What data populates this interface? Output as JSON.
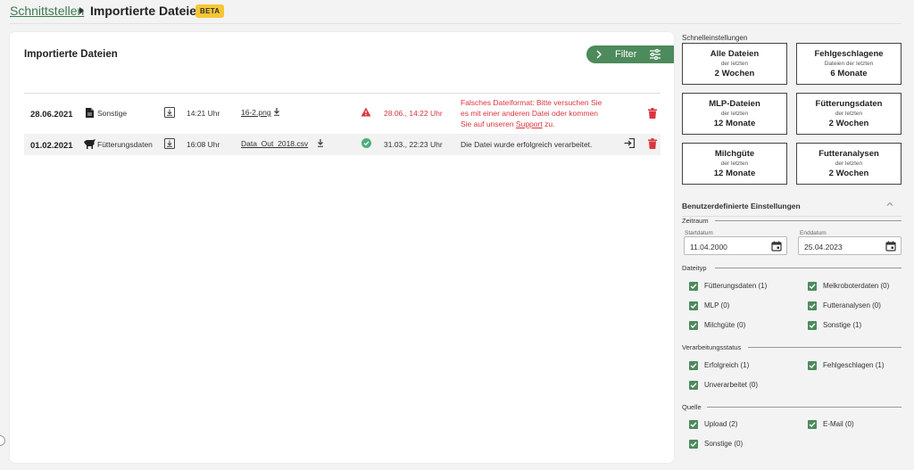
{
  "breadcrumb": {
    "parent": "Schnittstellen",
    "current": "Importierte Dateien",
    "badge": "BETA"
  },
  "main": {
    "title": "Importierte Dateien",
    "filter_label": "Filter",
    "rows": [
      {
        "date": "28.06.2021",
        "type": "Sonstige",
        "time": "14:21 Uhr",
        "file": "16-2.png",
        "processed": "28.06., 14:22 Uhr",
        "message_lines": [
          "Falsches Dateiformat: Bitte versuchen Sie",
          "es mit einer anderen Datei oder kommen",
          "Sie auf unseren"
        ],
        "support_link": "Support",
        "message_end": "zu.",
        "status": "error"
      },
      {
        "date": "01.02.2021",
        "type": "Fütterungsdaten",
        "time": "16:08 Uhr",
        "file": "Data_Out_2018.csv",
        "processed": "31.03., 22:23 Uhr",
        "message": "Die Datei wurde erfolgreich verarbeitet.",
        "status": "success"
      }
    ]
  },
  "sidebar": {
    "quick_title": "Schnelleinstellungen",
    "quick": [
      {
        "title": "Alle Dateien",
        "sub": "der letzten",
        "value": "2 Wochen"
      },
      {
        "title": "Fehlgeschlagene",
        "sub": "Dateien der letzten",
        "value": "6 Monate"
      },
      {
        "title": "MLP-Dateien",
        "sub": "der letzten",
        "value": "12 Monate"
      },
      {
        "title": "Fütterungsdaten",
        "sub": "der letzten",
        "value": "2 Wochen"
      },
      {
        "title": "Milchgüte",
        "sub": "der letzten",
        "value": "12 Monate"
      },
      {
        "title": "Futteranalysen",
        "sub": "der letzten",
        "value": "2 Wochen"
      }
    ],
    "custom_title": "Benutzerdefinierte Einstellungen",
    "zeitraum": {
      "label": "Zeitraum",
      "start_label": "Startdatum",
      "start_value": "11.04.2000",
      "end_label": "Enddatum",
      "end_value": "25.04.2023"
    },
    "dateityp": {
      "label": "Dateityp",
      "items": [
        "Fütterungsdaten (1)",
        "Melkroboterdaten (0)",
        "MLP (0)",
        "Futteranalysen (0)",
        "Milchgüte (0)",
        "Sonstige (1)"
      ]
    },
    "status": {
      "label": "Verarbeitungsstatus",
      "items": [
        "Erfolgreich (1)",
        "Fehlgeschlagen (1)",
        "Unverarbeitet (0)"
      ]
    },
    "quelle": {
      "label": "Quelle",
      "items": [
        "Upload (2)",
        "E-Mail (0)",
        "Sonstige (0)"
      ]
    }
  },
  "colors": {
    "accent": "#4d8a5c",
    "error": "#d9363e",
    "badge": "#f6c633",
    "success": "#4caf7a"
  }
}
